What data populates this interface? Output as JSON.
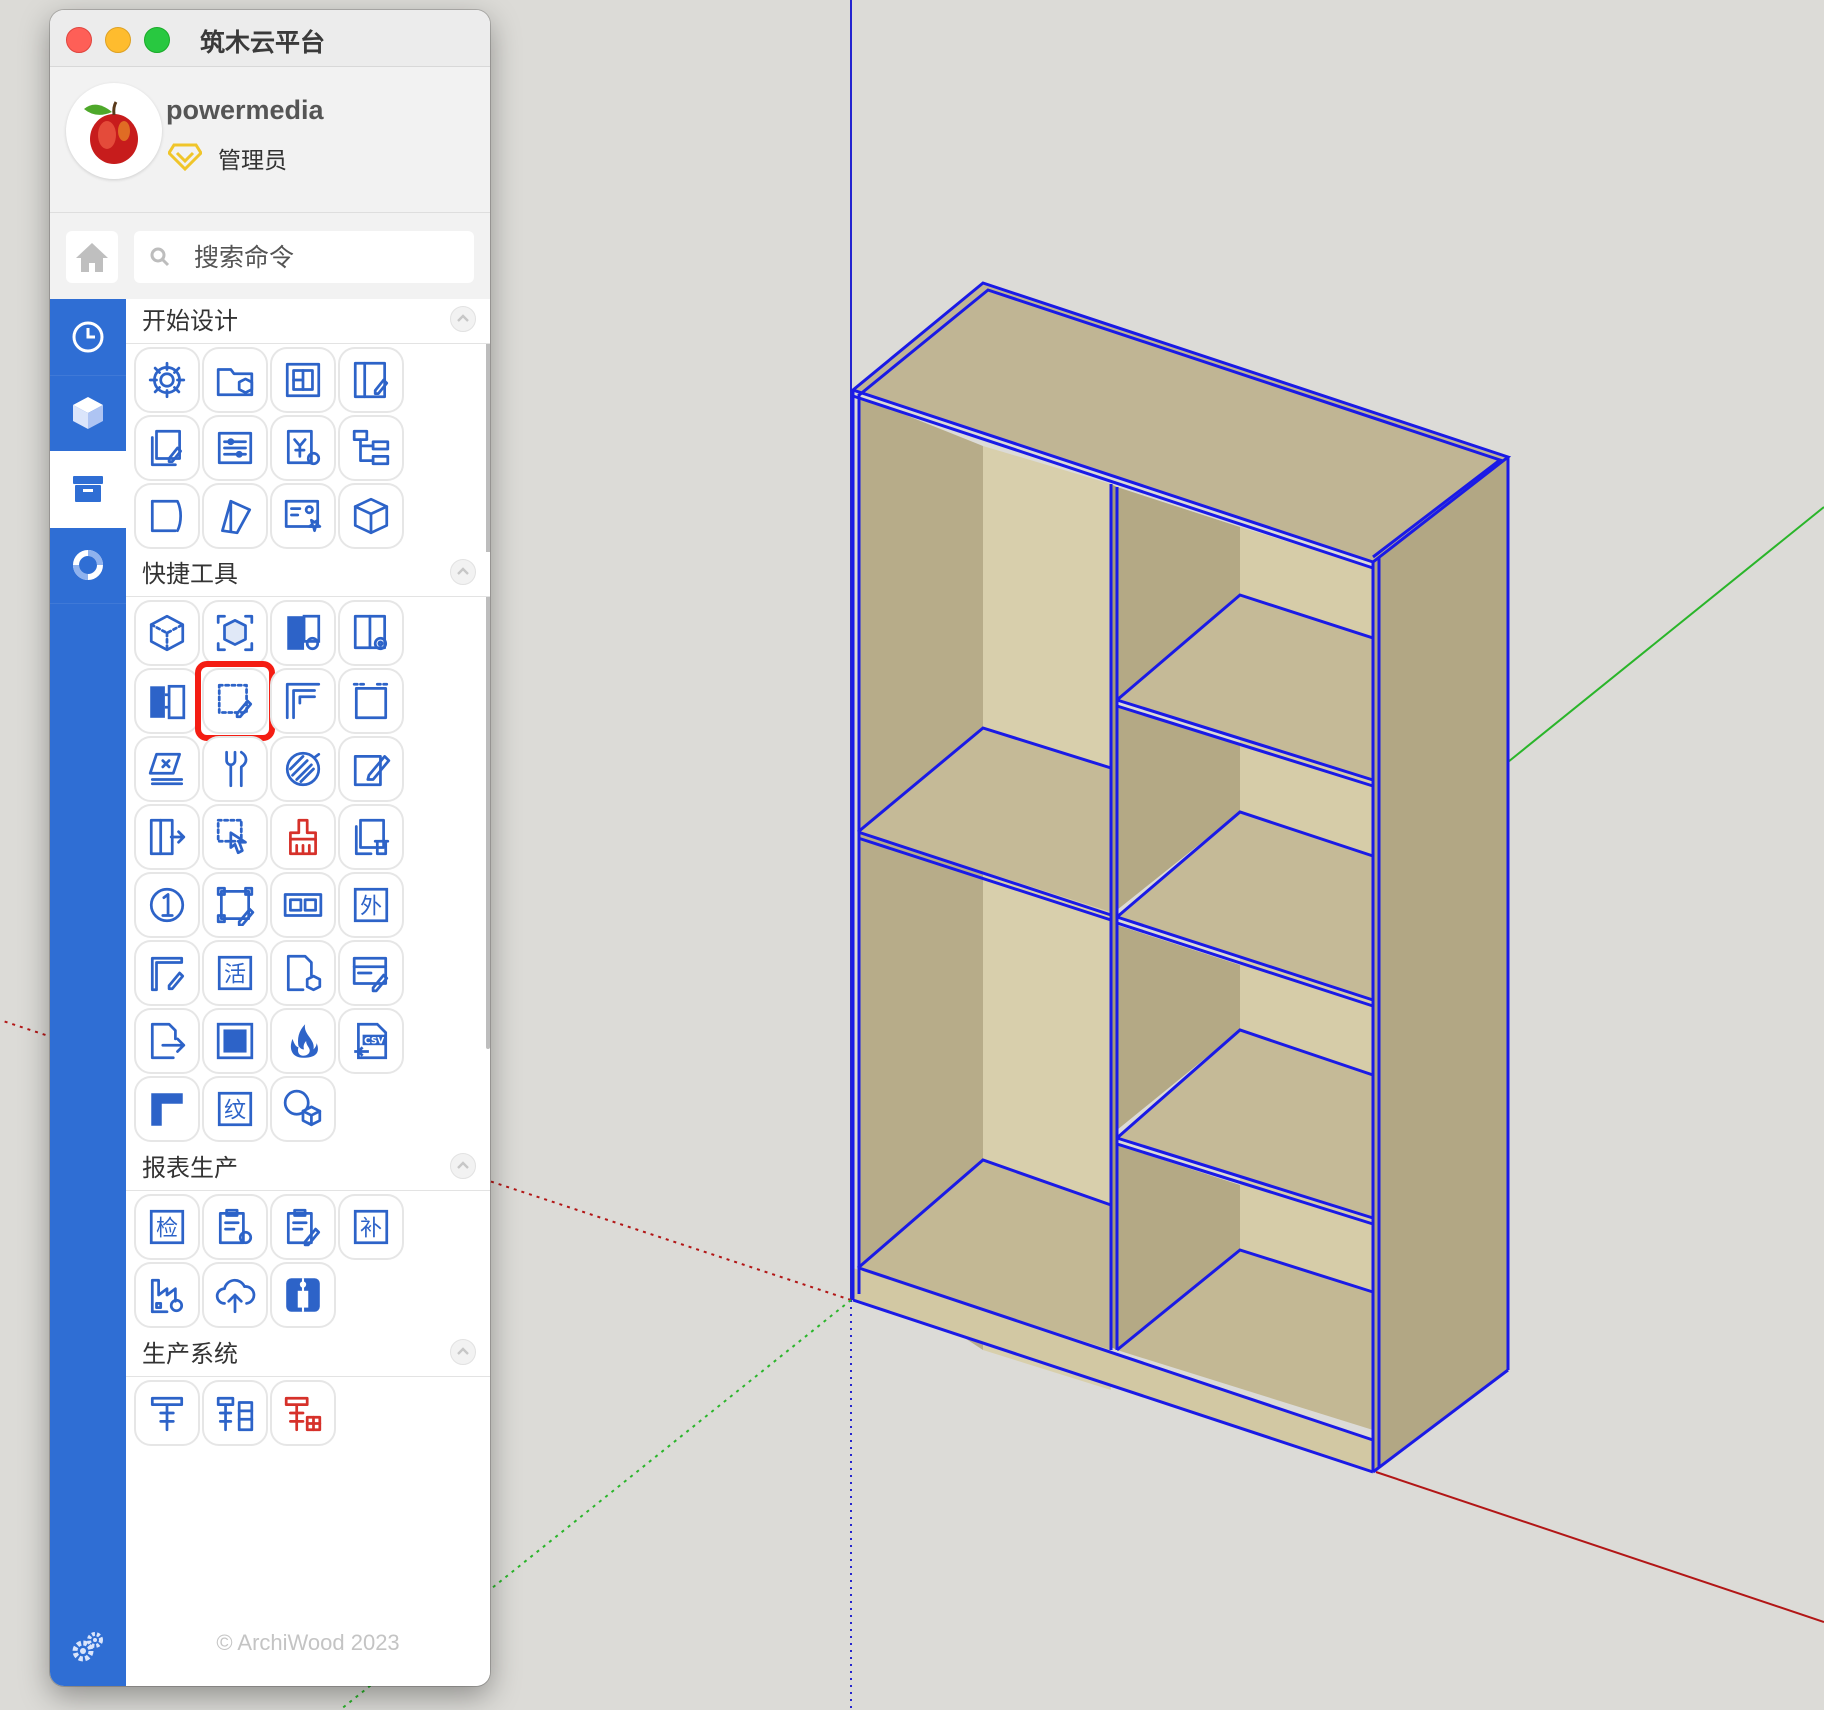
{
  "window": {
    "title": "筑木云平台"
  },
  "user": {
    "name": "powermedia",
    "role": "管理员",
    "avatar": "apple-avatar"
  },
  "search": {
    "placeholder": "搜索命令"
  },
  "left_nav": [
    {
      "icon": "clock-icon",
      "active": false
    },
    {
      "icon": "cube-icon",
      "active": false
    },
    {
      "icon": "cabinet-icon",
      "active": true
    },
    {
      "icon": "sync-icon",
      "active": false
    }
  ],
  "sections": [
    {
      "title": "开始设计",
      "tile_icons": [
        "gear",
        "folder-cube",
        "panel",
        "door-edit",
        "copy-edit",
        "list-settings",
        "price-settings",
        "tree",
        "curved-panel",
        "tag",
        "style-settings",
        "box"
      ]
    },
    {
      "title": "快捷工具",
      "tile_icons": [
        "cube-outline",
        "cube-select",
        "door-settings",
        "door-view",
        "cabinet-split",
        "panel-edit",
        "corner-dimension",
        "panel-frame",
        "measure",
        "tools",
        "grain-rotate",
        "pencil-edit",
        "door-exit",
        "hand-select",
        "brush",
        "copy-delete",
        "number-one",
        "frame-edit",
        "panel-slots",
        "outer",
        "corner-panel",
        "activity",
        "file-cube",
        "drawer-edit",
        "export-arrow",
        "solid-square",
        "fire",
        "csv-export",
        "l-shape",
        "texture",
        "sphere-cube"
      ],
      "glyphs": {
        "outer": "外",
        "activity": "活",
        "texture": "纹",
        "number-one": "1"
      }
    },
    {
      "title": "报表生产",
      "tile_icons": [
        "check",
        "clipboard-settings",
        "clipboard-edit",
        "supplement",
        "factory-settings",
        "cloud-upload",
        "info"
      ],
      "glyphs": {
        "check": "检",
        "supplement": "补"
      }
    },
    {
      "title": "生产系统",
      "tile_icons": [
        "hardware-1",
        "hardware-2",
        "hardware-3"
      ]
    }
  ],
  "highlighted_tile": "panel-edit",
  "footer": {
    "copyright": "© ArchiWood 2023"
  },
  "colors": {
    "accent": "#2f6ed4",
    "icon": "#2d63c8",
    "icon_red": "#d6312a",
    "highlight": "#f41d13",
    "model_edge": "#1a1ae6",
    "wood": "#bfb38f",
    "axis_red": "#b81414",
    "axis_green": "#2ab52a",
    "axis_blue": "#1e1ec8"
  }
}
